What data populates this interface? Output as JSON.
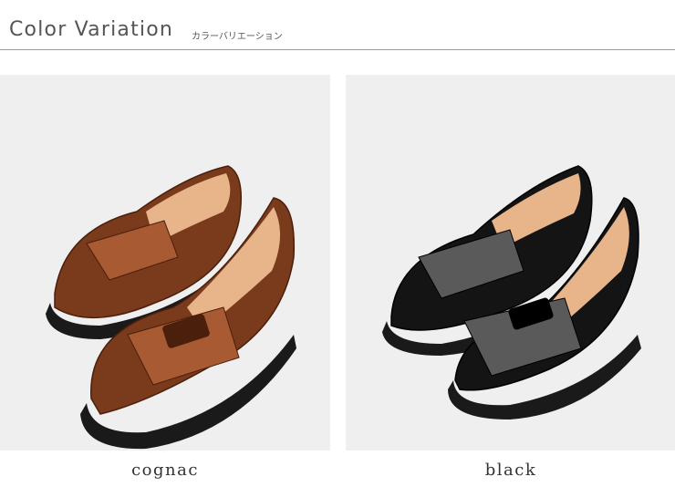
{
  "header": {
    "title": "Color Variation",
    "subtitle": "カラーバリエーション"
  },
  "variations": [
    {
      "label": "cognac",
      "image_name": "cognac-loafers-photo",
      "shoe_color": "#7a3a1c",
      "shoe_highlight": "#a85a32",
      "shoe_dark": "#4a1f0c"
    },
    {
      "label": "black",
      "image_name": "black-loafers-photo",
      "shoe_color": "#141414",
      "shoe_highlight": "#5a5a5a",
      "shoe_dark": "#000000"
    }
  ],
  "colors": {
    "panel_bg": "#efefef",
    "lining": "#e8b48a",
    "sole": "#1a1a1a",
    "text": "#555555"
  }
}
